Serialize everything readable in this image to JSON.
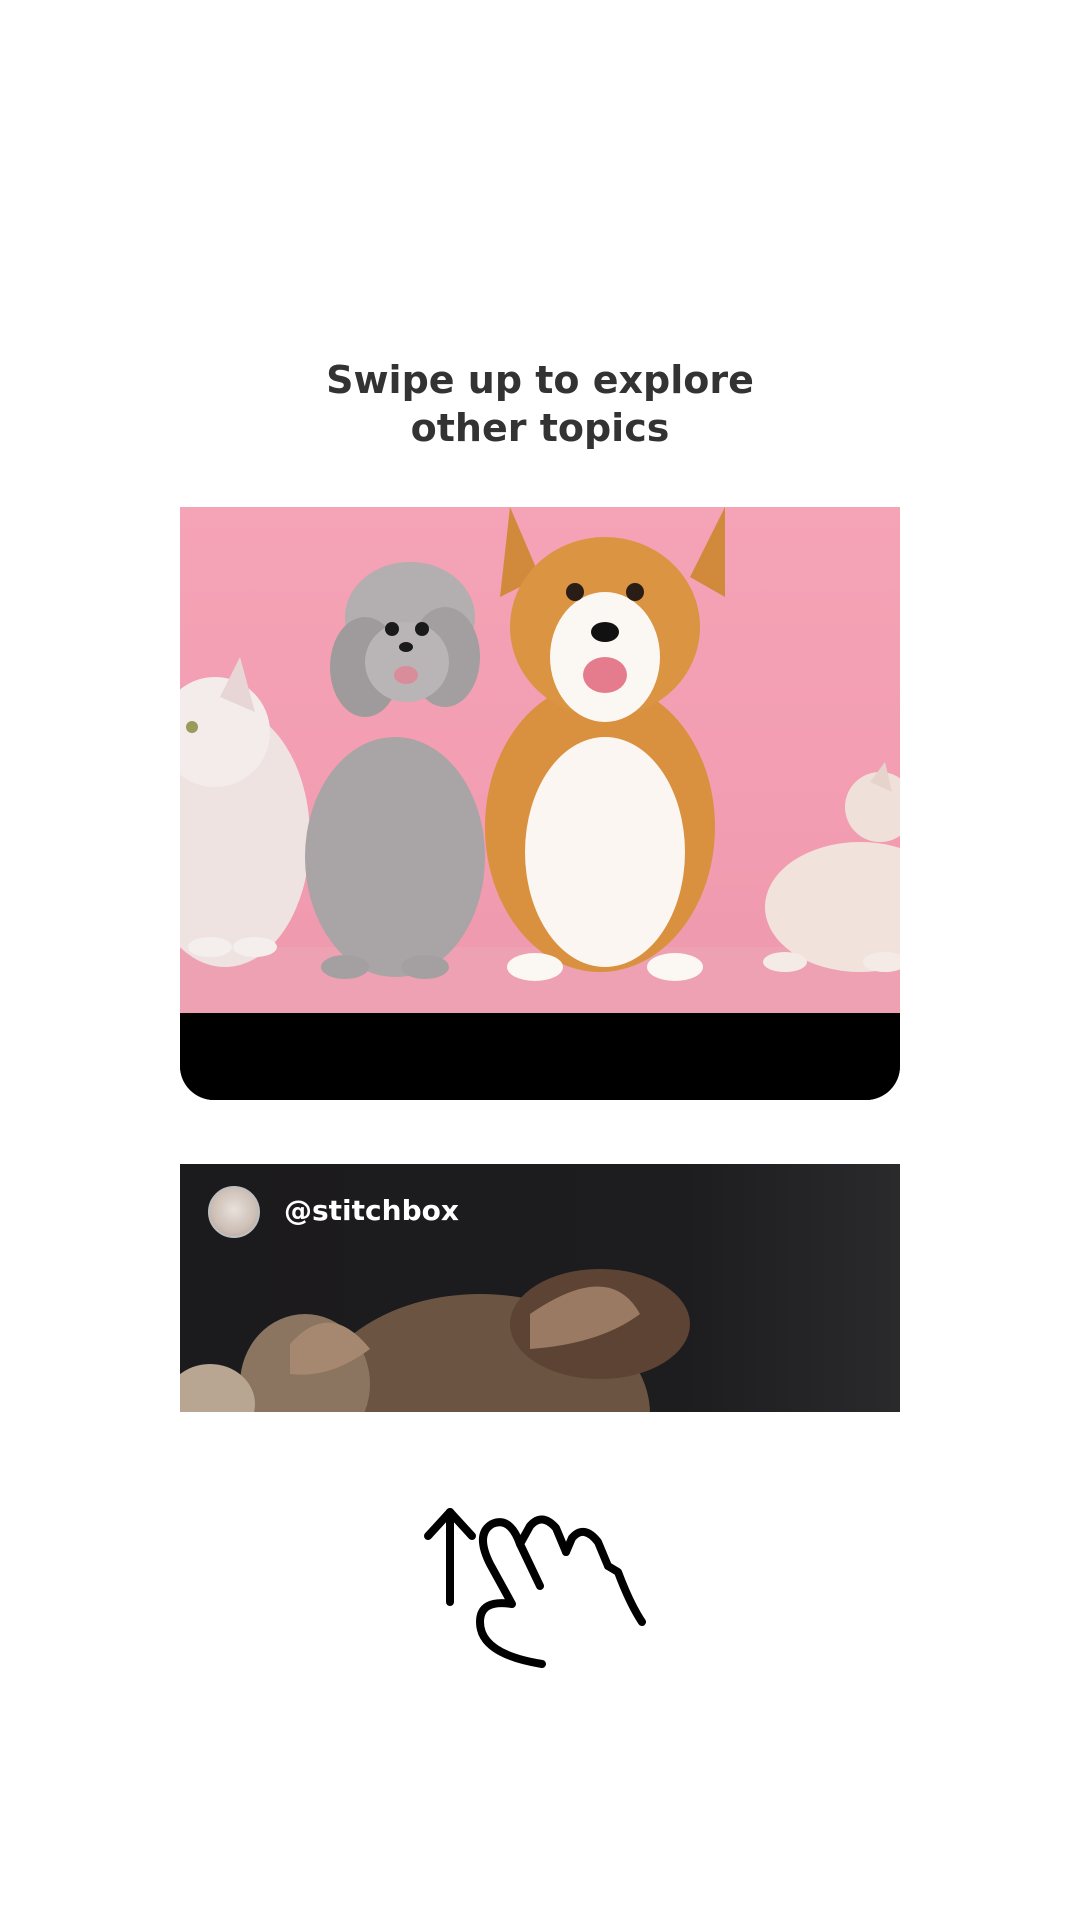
{
  "prompt": {
    "line1": "Swipe up to explore",
    "line2": "other topics"
  },
  "next_post": {
    "username": "@stitchbox"
  },
  "icons": [
    "swipe-up-arrow-icon",
    "hand-gesture-icon"
  ],
  "colors": {
    "headline": "#333333",
    "pink_background": "#f29cb1",
    "card_footer": "#000000",
    "next_card_background": "#1d1c1f"
  }
}
